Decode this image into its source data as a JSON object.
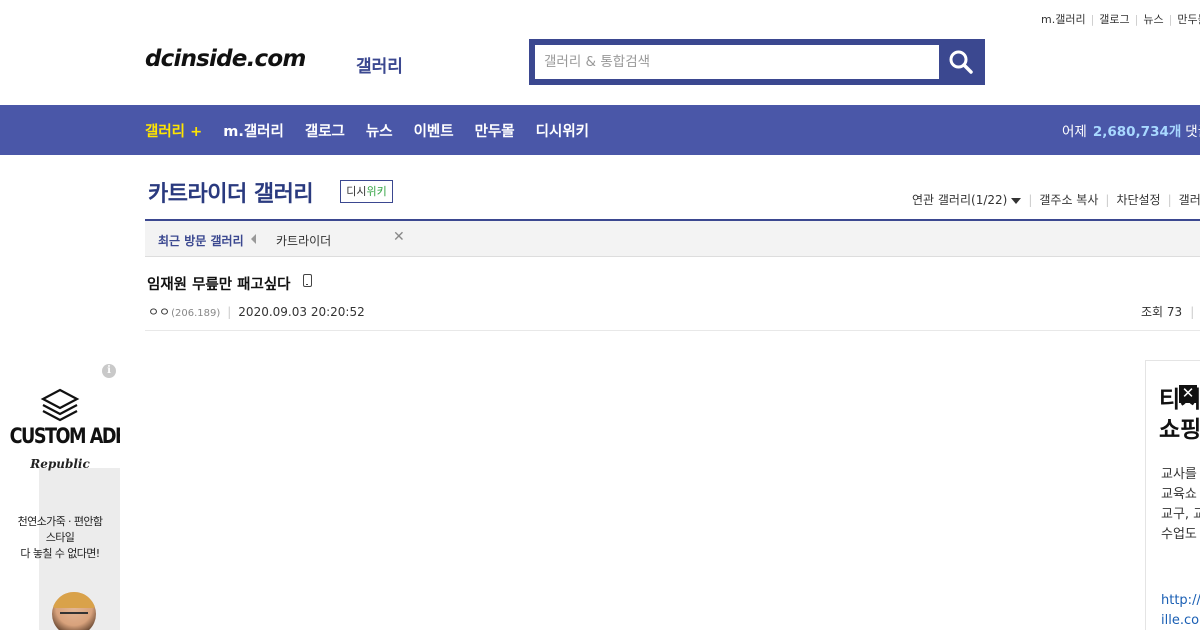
{
  "top_menu": [
    "m.갤러리",
    "갤로그",
    "뉴스",
    "만두몰"
  ],
  "logo": {
    "text": "dcinside.com",
    "sub": "갤러리"
  },
  "search": {
    "placeholder": "갤러리 & 통합검색",
    "icon": "search-icon"
  },
  "gnb": {
    "items": [
      "갤러리 +",
      "m.갤러리",
      "갤로그",
      "뉴스",
      "이벤트",
      "만두몰",
      "디시위키"
    ],
    "stats_label": "어제",
    "stats_value": "2,680,734개",
    "stats_suffix": "댓글"
  },
  "gallery": {
    "title": "카트라이더 갤러리",
    "wiki_prefix": "디시",
    "wiki_suffix": "위키",
    "related": "연관 갤러리(1/22)",
    "actions": [
      "갤주소 복사",
      "차단설정",
      "갤러리"
    ]
  },
  "recent": {
    "label": "최근 방문 갤러리",
    "items": [
      "카트라이더"
    ]
  },
  "post": {
    "title": "임재원 무릎만 패고싶다",
    "author": "ㅇㅇ",
    "ip": "(206.189)",
    "date": "2020.09.03 20:20:52",
    "views_label": "조회",
    "views": "73"
  },
  "ad_left": {
    "brand": "CUSTOM ADE",
    "script": "Republic",
    "copy": [
      "천연소가죽 · 편안함",
      "스타일",
      "다 놓칠 수 없다면!"
    ],
    "info": "i"
  },
  "ad_right": {
    "title": [
      "티처",
      "쇼핑"
    ],
    "body": [
      "교사를",
      "교육쇼",
      "교구, 교",
      "수업도"
    ],
    "url": [
      "http://s",
      "ille.co.kr"
    ]
  },
  "colors": {
    "brand_blue": "#3b4890",
    "nav_blue": "#4a57a8",
    "active_yellow": "#ffe500",
    "stats_blue": "#a8d8ff"
  }
}
